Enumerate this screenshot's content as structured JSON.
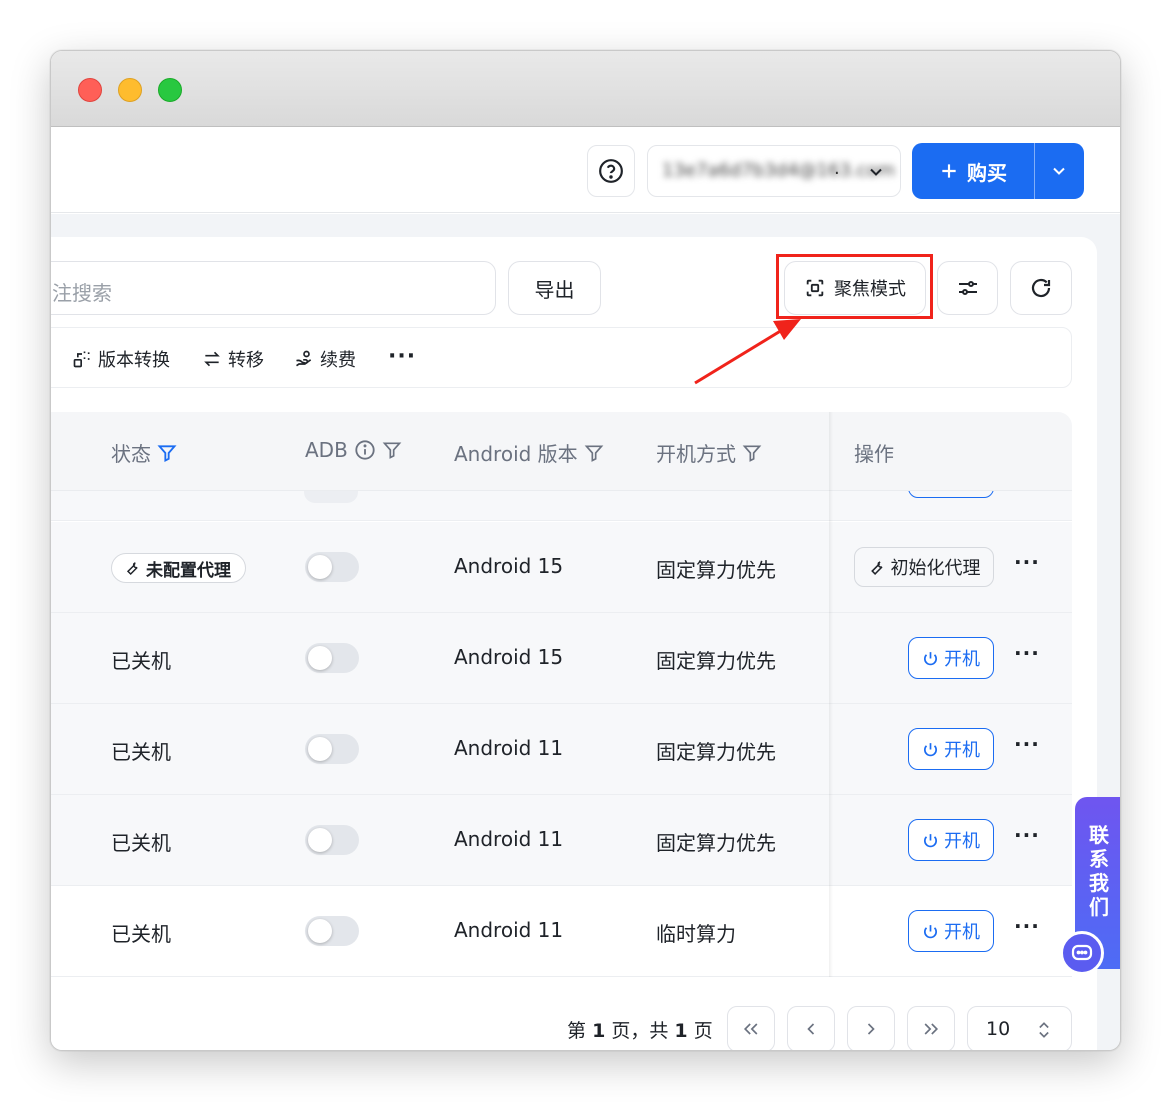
{
  "header": {
    "account_text": "13e7a6d7b3d4@163.com",
    "account_dots": ".",
    "buy_label": "购买"
  },
  "toolbar": {
    "search_placeholder": "注搜索",
    "export_label": "导出",
    "focus_label": "聚焦模式"
  },
  "actions": [
    {
      "label": "版本转换",
      "icon": "version-convert-icon"
    },
    {
      "label": "转移",
      "icon": "transfer-icon"
    },
    {
      "label": "续费",
      "icon": "renew-icon"
    }
  ],
  "table": {
    "columns": {
      "status": "状态",
      "adb": "ADB",
      "android_version": "Android 版本",
      "boot_mode": "开机方式",
      "operations": "操作"
    },
    "rows": [
      {
        "status": "未配置代理",
        "status_is_badge": true,
        "version": "Android 15",
        "boot": "固定算力优先",
        "op": "初始化代理"
      },
      {
        "status": "已关机",
        "version": "Android 15",
        "boot": "固定算力优先",
        "op": "开机"
      },
      {
        "status": "已关机",
        "version": "Android 11",
        "boot": "固定算力优先",
        "op": "开机"
      },
      {
        "status": "已关机",
        "version": "Android 11",
        "boot": "固定算力优先",
        "op": "开机"
      },
      {
        "status": "已关机",
        "version": "Android 11",
        "boot": "临时算力",
        "op": "开机"
      }
    ]
  },
  "pagination": {
    "prefix": "第",
    "page": "1",
    "mid": "页，共",
    "total": "1",
    "suffix": "页",
    "page_size": "10"
  },
  "contact": {
    "label": "联系我们"
  },
  "colors": {
    "primary": "#1b6cf2",
    "highlight": "#f0231b",
    "contact": "#5b5cf0"
  }
}
